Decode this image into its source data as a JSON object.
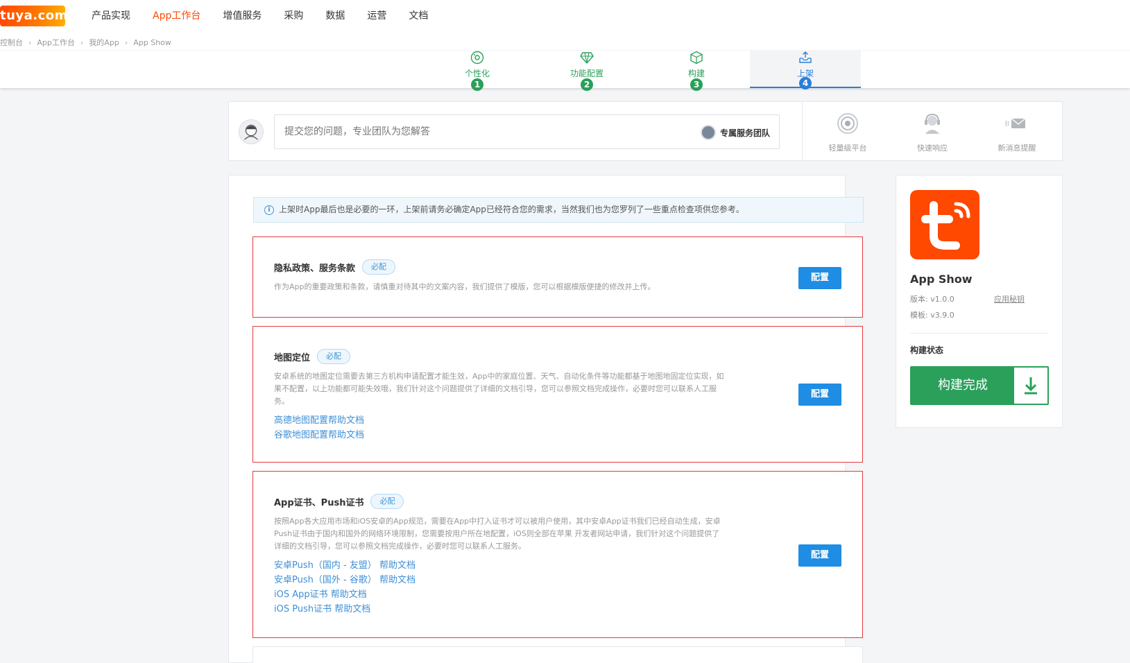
{
  "header": {
    "logo_text": "tuya.com",
    "nav": [
      {
        "label": "产品实现",
        "active": false
      },
      {
        "label": "App工作台",
        "active": true
      },
      {
        "label": "增值服务",
        "active": false
      },
      {
        "label": "采购",
        "active": false
      },
      {
        "label": "数据",
        "active": false
      },
      {
        "label": "运营",
        "active": false
      },
      {
        "label": "文档",
        "active": false
      }
    ],
    "breadcrumb": [
      "控制台",
      "App工作台",
      "我的App",
      "App Show"
    ]
  },
  "steps": [
    {
      "label": "个性化",
      "num": "1",
      "icon": "palette-icon"
    },
    {
      "label": "功能配置",
      "num": "2",
      "icon": "diamond-icon"
    },
    {
      "label": "构建",
      "num": "3",
      "icon": "cube-icon"
    },
    {
      "label": "上架",
      "num": "4",
      "icon": "upload-tray-icon",
      "active": true
    }
  ],
  "help": {
    "placeholder": "提交您的问题，专业团队为您解答",
    "team_label": "专属服务团队",
    "features": [
      {
        "label": "轻量级平台",
        "icon": "target-icon"
      },
      {
        "label": "快速响应",
        "icon": "headset-icon"
      },
      {
        "label": "新消息提醒",
        "icon": "envelope-icon"
      }
    ]
  },
  "notice": "上架时App最后也是必要的一环，上架前请务必确定App已经符合您的需求，当然我们也为您罗列了一些重点检查项供您参考。",
  "cards": [
    {
      "title": "隐私政策、服务条款",
      "badge": "必配",
      "desc": "作为App的重要政策和条款，请慎重对待其中的文案内容，我们提供了模版，您可以根据模版便捷的修改并上传。",
      "links": [],
      "button": "配置"
    },
    {
      "title": "地图定位",
      "badge": "必配",
      "desc": "安卓系统的地图定位需要去第三方机构申请配置才能生效，App中的家庭位置、天气、自动化条件等功能都基于地图地固定位实现，如果不配置，以上功能都可能失效哦，我们针对这个问题提供了详细的文档引导，您可以参照文档完成操作，必要时您可以联系人工服务。",
      "links": [
        "高德地图配置帮助文档",
        "谷歌地图配置帮助文档"
      ],
      "button": "配置"
    },
    {
      "title": "App证书、Push证书",
      "badge": "必配",
      "desc": "按照App各大应用市场和iOS安卓的App规范，需要在App中打入证书才可以被用户使用，其中安卓App证书我们已经自动生成，安卓Push证书由于国内和国外的网络环境限制，您需要按用户所在地配置，iOS则全部在苹果 开发者网站申请，我们针对这个问题提供了详细的文档引导，您可以参照文档完成操作，必要时您可以联系人工服务。",
      "links": [
        "安卓Push（国内 - 友盟） 帮助文档",
        "安卓Push（国外 - 谷歌） 帮助文档",
        "iOS App证书 帮助文档",
        "iOS Push证书 帮助文档"
      ],
      "button": "配置"
    }
  ],
  "app": {
    "name": "App Show",
    "version": "版本: v1.0.0",
    "template": "模板: v3.9.0",
    "secret_link": "应用秘钥",
    "build_status_label": "构建状态",
    "build_button": "构建完成",
    "icon_color": "#ff4800"
  },
  "colors": {
    "brand": "#ff4800",
    "step_done": "#2aa05a",
    "step_active": "#2a7ed6",
    "card_border": "#e4393c",
    "config_button": "#1f8de3"
  }
}
